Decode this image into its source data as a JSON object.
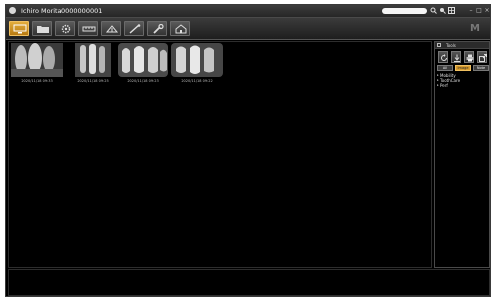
{
  "titlebar": {
    "patient_name": "Ichiro Morita",
    "patient_id": "0000000001",
    "search_value": "",
    "icons": [
      "zoom-in-icon",
      "zoom-out-icon",
      "grid-icon"
    ],
    "window_buttons": [
      "minimize-icon",
      "maximize-icon",
      "close-icon"
    ]
  },
  "toolbar": {
    "buttons": [
      {
        "icon": "monitor-icon",
        "active": true
      },
      {
        "icon": "folder-icon",
        "active": false
      },
      {
        "icon": "gear-icon",
        "active": false
      },
      {
        "icon": "ruler-icon",
        "active": false
      },
      {
        "icon": "share-icon",
        "active": false
      },
      {
        "icon": "measure-icon",
        "active": false
      },
      {
        "icon": "wrench-icon",
        "active": false
      },
      {
        "icon": "home-icon",
        "active": false
      }
    ],
    "accent_color": "#d69b2e"
  },
  "thumbnails": [
    {
      "caption": "2020/11/18 09:33"
    },
    {
      "caption": "2020/11/18 09:25"
    },
    {
      "caption": "2020/11/18 09:23"
    },
    {
      "caption": "2020/11/18 09:22"
    }
  ],
  "side_panel": {
    "title": "Tools",
    "tools": [
      "rotate-icon",
      "download-icon",
      "print-icon",
      "export-icon"
    ],
    "filter_tabs": [
      {
        "label": "All",
        "active": false
      },
      {
        "label": "Image",
        "active": true
      },
      {
        "label": "Note",
        "active": false
      }
    ],
    "tree_items": [
      "Mobility",
      "ToothCare",
      "Perf"
    ]
  }
}
